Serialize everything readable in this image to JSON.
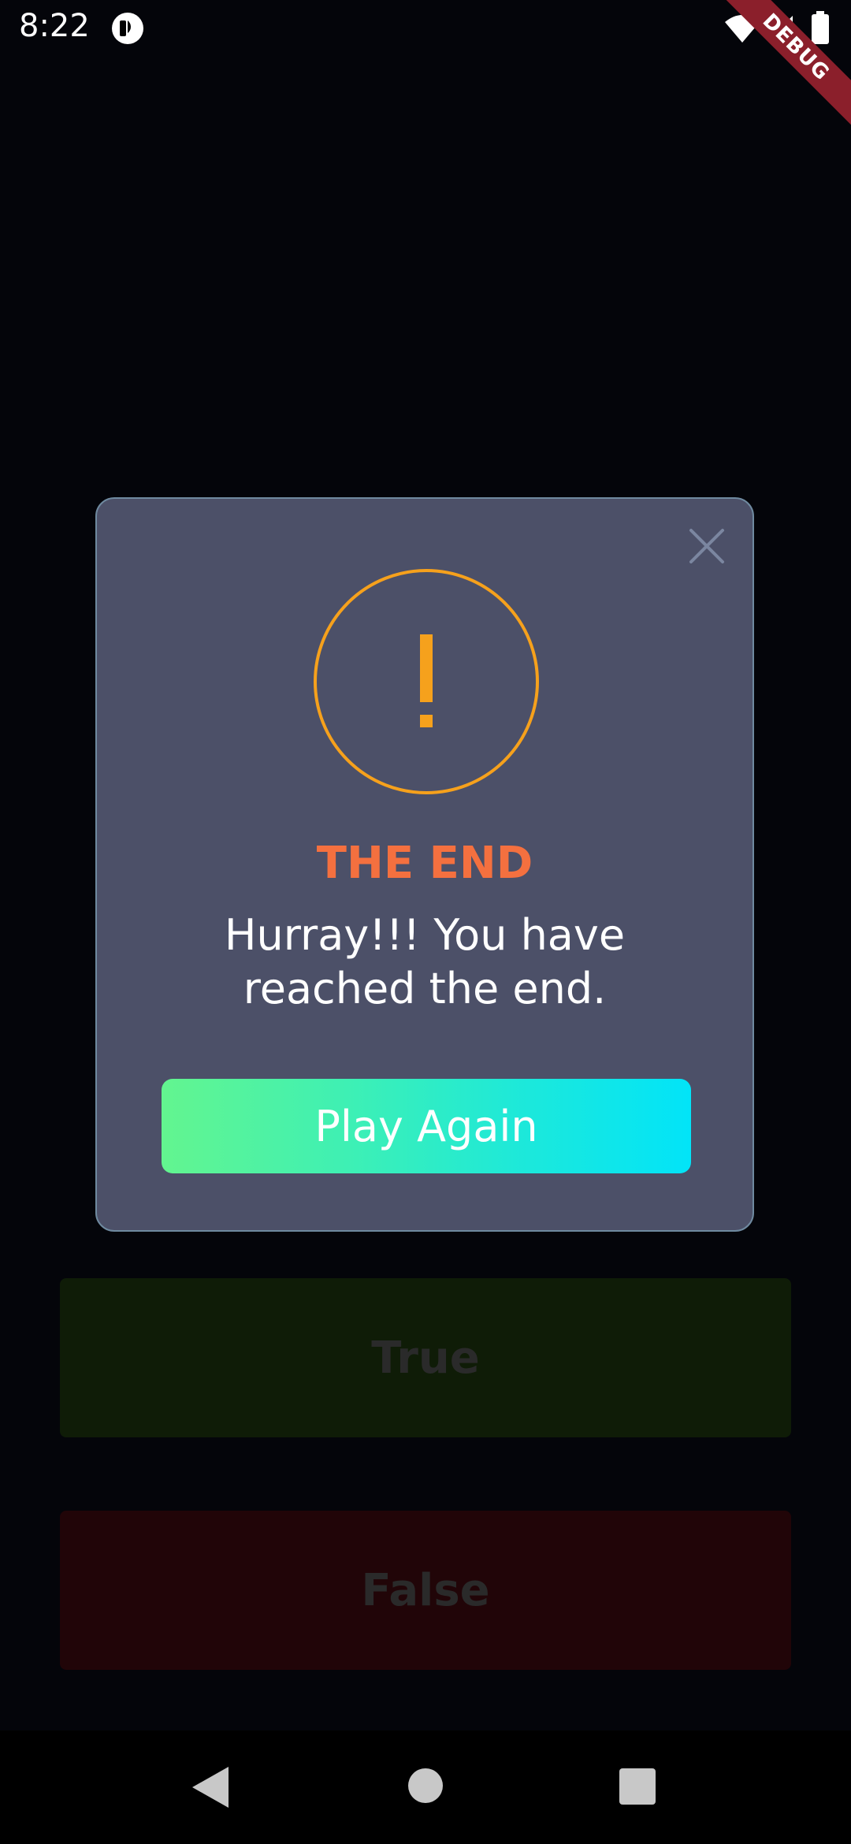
{
  "status_bar": {
    "time": "8:22",
    "icons": [
      "app-badge-icon",
      "wifi-icon",
      "signal-icon",
      "battery-icon"
    ],
    "debug_label": "DEBUG"
  },
  "answers": {
    "true_label": "True",
    "false_label": "False"
  },
  "dialog": {
    "icon": "warning-icon",
    "icon_color": "#f6a11c",
    "title": "THE END",
    "title_color": "#f4703f",
    "message": "Hurray!!! You have reached the end.",
    "button_label": "Play Again",
    "close_icon": "close-icon"
  },
  "nav_bar": {
    "icons": [
      "nav-back-icon",
      "nav-home-icon",
      "nav-recents-icon"
    ]
  }
}
